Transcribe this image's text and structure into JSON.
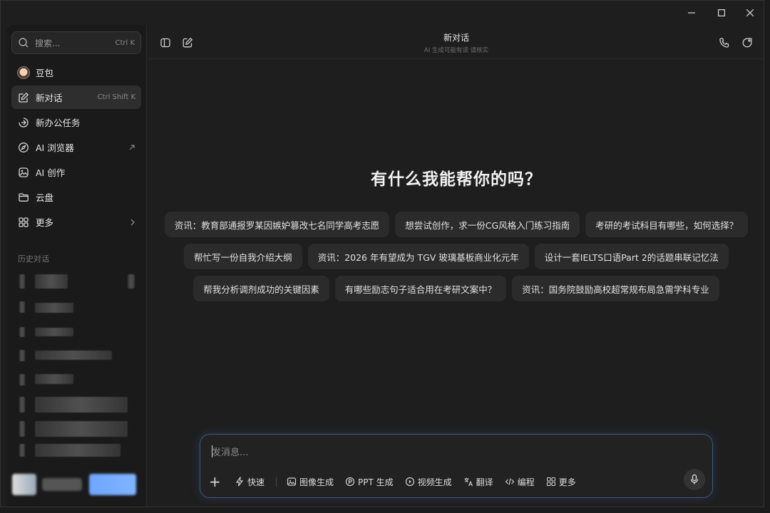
{
  "sidebar": {
    "search": {
      "placeholder": "搜索...",
      "shortcut": "Ctrl K"
    },
    "items": [
      {
        "label": "豆包",
        "shortcut": ""
      },
      {
        "label": "新对话",
        "shortcut": "Ctrl Shift K"
      },
      {
        "label": "新办公任务",
        "shortcut": ""
      },
      {
        "label": "AI 浏览器",
        "shortcut": ""
      },
      {
        "label": "AI 创作",
        "shortcut": ""
      },
      {
        "label": "云盘",
        "shortcut": ""
      },
      {
        "label": "更多",
        "shortcut": ""
      }
    ],
    "history_title": "历史对话"
  },
  "conversation": {
    "title": "新对话",
    "subtitle": "AI 生成可能有误 请核实"
  },
  "heading": "有什么我能帮你的吗？",
  "suggestions": [
    [
      "资讯：教育部通报罗某因嫉妒篡改七名同学高考志愿",
      "想尝试创作，求一份CG风格入门练习指南",
      "考研的考试科目有哪些，如何选择？"
    ],
    [
      "帮忙写一份自我介绍大纲",
      "资讯：2026 年有望成为 TGV 玻璃基板商业化元年",
      "设计一套IELTS口语Part 2的话题串联记忆法"
    ],
    [
      "帮我分析调剂成功的关键因素",
      "有哪些励志句子适合用在考研文案中？",
      "资讯：国务院鼓励高校超常规布局急需学科专业"
    ]
  ],
  "composer": {
    "placeholder": "发消息...",
    "tools": [
      {
        "label": "快速",
        "icon": "bolt-icon"
      },
      {
        "label": "图像生成",
        "icon": "image-icon"
      },
      {
        "label": "PPT 生成",
        "icon": "ppt-icon"
      },
      {
        "label": "视频生成",
        "icon": "video-icon"
      },
      {
        "label": "翻译",
        "icon": "translate-icon"
      },
      {
        "label": "编程",
        "icon": "code-icon"
      },
      {
        "label": "更多",
        "icon": "grid-icon"
      }
    ]
  }
}
